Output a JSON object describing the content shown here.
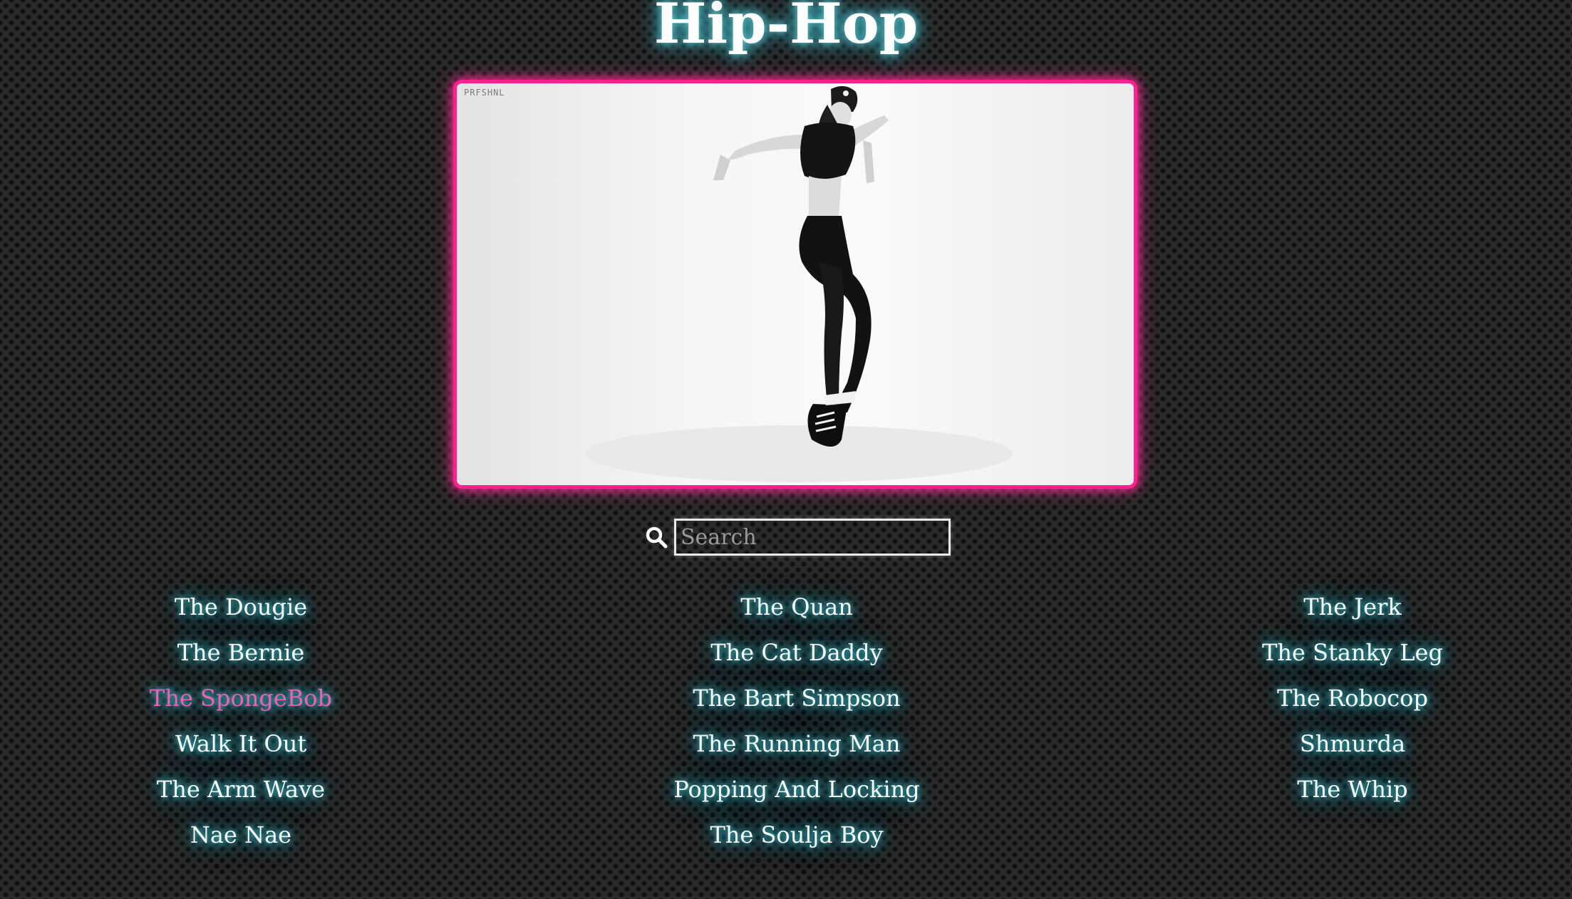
{
  "page": {
    "title": "Hip-Hop"
  },
  "video": {
    "watermark": "PRFSHNL",
    "border_color": "#ff1f8e"
  },
  "search": {
    "icon": "search-icon",
    "placeholder": "Search",
    "value": ""
  },
  "dance_columns": [
    {
      "items": [
        {
          "label": "The Dougie",
          "active": false
        },
        {
          "label": "The Bernie",
          "active": false
        },
        {
          "label": "The SpongeBob",
          "active": true
        },
        {
          "label": "Walk It Out",
          "active": false
        },
        {
          "label": "The Arm Wave",
          "active": false
        },
        {
          "label": "Nae Nae",
          "active": false
        }
      ]
    },
    {
      "items": [
        {
          "label": "The Quan",
          "active": false
        },
        {
          "label": "The Cat Daddy",
          "active": false
        },
        {
          "label": "The Bart Simpson",
          "active": false
        },
        {
          "label": "The Running Man",
          "active": false
        },
        {
          "label": "Popping And Locking",
          "active": false
        },
        {
          "label": "The Soulja Boy",
          "active": false
        }
      ]
    },
    {
      "items": [
        {
          "label": "The Jerk",
          "active": false
        },
        {
          "label": "The Stanky Leg",
          "active": false
        },
        {
          "label": "The Robocop",
          "active": false
        },
        {
          "label": "Shmurda",
          "active": false
        },
        {
          "label": "The Whip",
          "active": false
        }
      ]
    }
  ],
  "colors": {
    "accent_pink": "#ff1f8e",
    "active_item": "#f061b6",
    "glow_teal": "#3ec7d3"
  }
}
